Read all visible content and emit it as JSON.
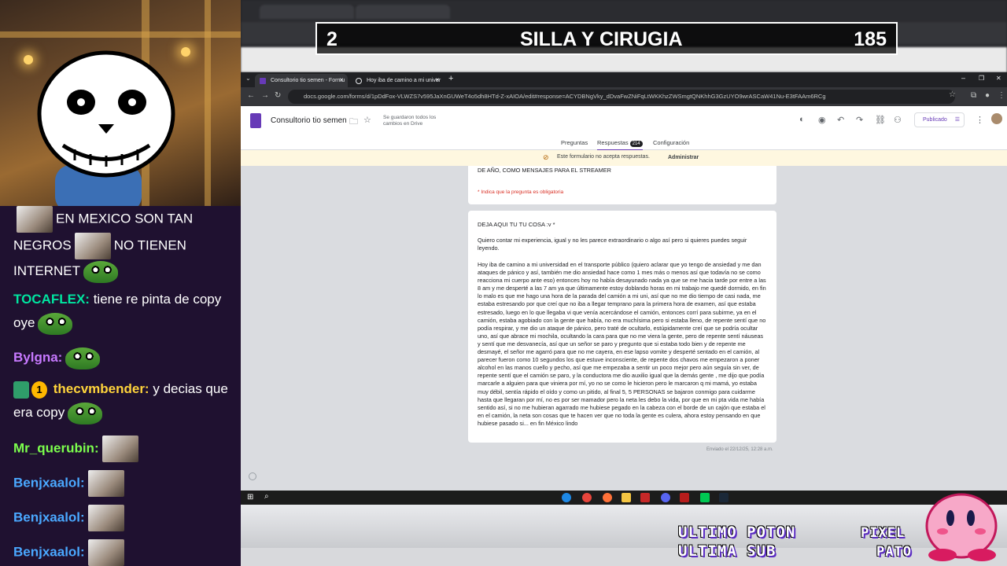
{
  "overlay": {
    "number_left": "2",
    "title": "SILLA Y CIRUGIA",
    "number_right": "185"
  },
  "chat": {
    "messages": [
      {
        "user": "",
        "text_1": "EN MEXICO SON TAN",
        "text_2": "NEGROS",
        "text_3": "NO TIENEN",
        "text_4": "INTERNET",
        "user_color": "#ffffff"
      },
      {
        "user": "TOCAFLEX:",
        "text": "tiene re pinta de copy oye",
        "user_color": "#00e5a0"
      },
      {
        "user": "Bylgna:",
        "text": "",
        "user_color": "#c779ff"
      },
      {
        "user": "thecvmbender:",
        "text": "y decias que era copy",
        "user_color": "#ffd43b",
        "badge": "1"
      },
      {
        "user": "Mr_querubin:",
        "text": "",
        "user_color": "#7cff4d"
      },
      {
        "user": "Benjxaalol:",
        "text": "",
        "user_color": "#4aa8ff"
      },
      {
        "user": "Benjxaalol:",
        "text": "",
        "user_color": "#4aa8ff"
      },
      {
        "user": "Benjxaalol:",
        "text": "",
        "user_color": "#4aa8ff"
      }
    ]
  },
  "browser": {
    "tabs": [
      {
        "label": "Consultorio tio semen - Formu"
      },
      {
        "label": "Hoy iba de camino a mi univer"
      }
    ],
    "new_tab": "+",
    "url": "docs.google.com/forms/d/1pDdFox-VLWZS7v595JaXnGUWeT4o5dh8HTd-Z-xAIOA/edit#response=ACYDBNgVky_dDvaFwZNiFqLtWKKhzZWSmgtQNKhhG3GzUYO9wrASCaW41Nu-E3tFAAm6RCg"
  },
  "forms": {
    "title": "Consultorio tio semen",
    "saved_note": "Se guardaron todos los cambios en Drive",
    "publish_label": "Publicado",
    "tabs": [
      "Preguntas",
      "Respuestas",
      "Configuración"
    ],
    "responses_count": "214",
    "notice": "Este formulario no acepta respuestas.",
    "notice_action": "Administrar",
    "card1_text": "DE AÑO, COMO MENSAJES PARA EL STREAMER",
    "required_note": "* Indica que la pregunta es obligatoria",
    "question": "DEJA AQUI TU TU COSA :v *",
    "answer_intro": "Quiero contar mi experiencia, igual y no les parece extraordinario o algo así pero si quieres puedes seguir leyendo.",
    "answer_body": "Hoy iba de camino a mi universidad en el transporte público (quiero aclarar que yo tengo de ansiedad y me dan ataques de pánico y así, también me dio ansiedad hace como 1 mes más o menos así que todavía no se como reacciona mi cuerpo ante eso) entonces hoy no había desayunado nada ya que se me hacia tarde por entre a las 8 am y me desperté a las 7 am ya que últimamente estoy doblando horas en mi trabajo me quedé dormido, en fin lo malo es que me hago una hora de la parada del camión a mi uni, así que no me dio tiempo de casi nada, me estaba estresando por que creí que no iba a llegar temprano para la primera hora de examen, así que estaba estresado, luego en lo que llegaba vi que venía acercándose el camión, entonces corrí para subirme, ya en el camión, estaba agobiado con la gente que había, no era muchísima pero si estaba lleno, de repente sentí que no podía respirar, y me dio un ataque de pánico, pero traté de ocultarlo, estúpidamente creí que se podría ocultar uno, así que abrace mi mochila, ocultando la cara para que no me viera la gente, pero de repente sentí náuseas y sentí que me desvanecía, así que un señor se paro y pregunto que si estaba todo bien y de repente me desmayé, el señor me agarró para que no me cayera, en ese lapso vomite y desperté sentado en el camión, al parecer fueron como 10 segundos los que estuve inconsciente, de repente dos chavos me empezaron a poner alcohol en las manos cuello y pecho, así que me empezaba a sentir un poco mejor pero aún seguía sin ver, de repente sentí que el camión se paro, y la conductora me dio auxilio igual que la demás gente , me dijo que podía marcarle a alguien para que viniera por mí, yo no se como le hicieron pero le marcaron q mi mamá, yo estaba muy débil, sentía rápido el oído y como un pitido, al final 5, 5 PERSONAS se bajaron conmigo para cuidarme hasta que llegaran por mí, no es por ser mamador pero la neta les debo la vida, por que en mi pta vida me había sentido así, si no me hubieran agarrado me hubiese pegado en la cabeza con el borde de un cajón que estaba el en el camión, la neta son cosas que te hacen ver que no toda la gente es culera, ahora estoy pensando en que hubiese pasado si... en fin México lindo",
    "submitted": "Enviado el 22/12/25, 12:28 a.m."
  },
  "overlays_bottom": {
    "line1": "ULTIMO POTON",
    "line2": "ULTIMA SUB",
    "right1": "PIXEL",
    "right2": "PATO"
  },
  "colors": {
    "chat_bg": "#1f1130",
    "forms_purple": "#673ab7",
    "notice_bg": "#fef7e0"
  }
}
